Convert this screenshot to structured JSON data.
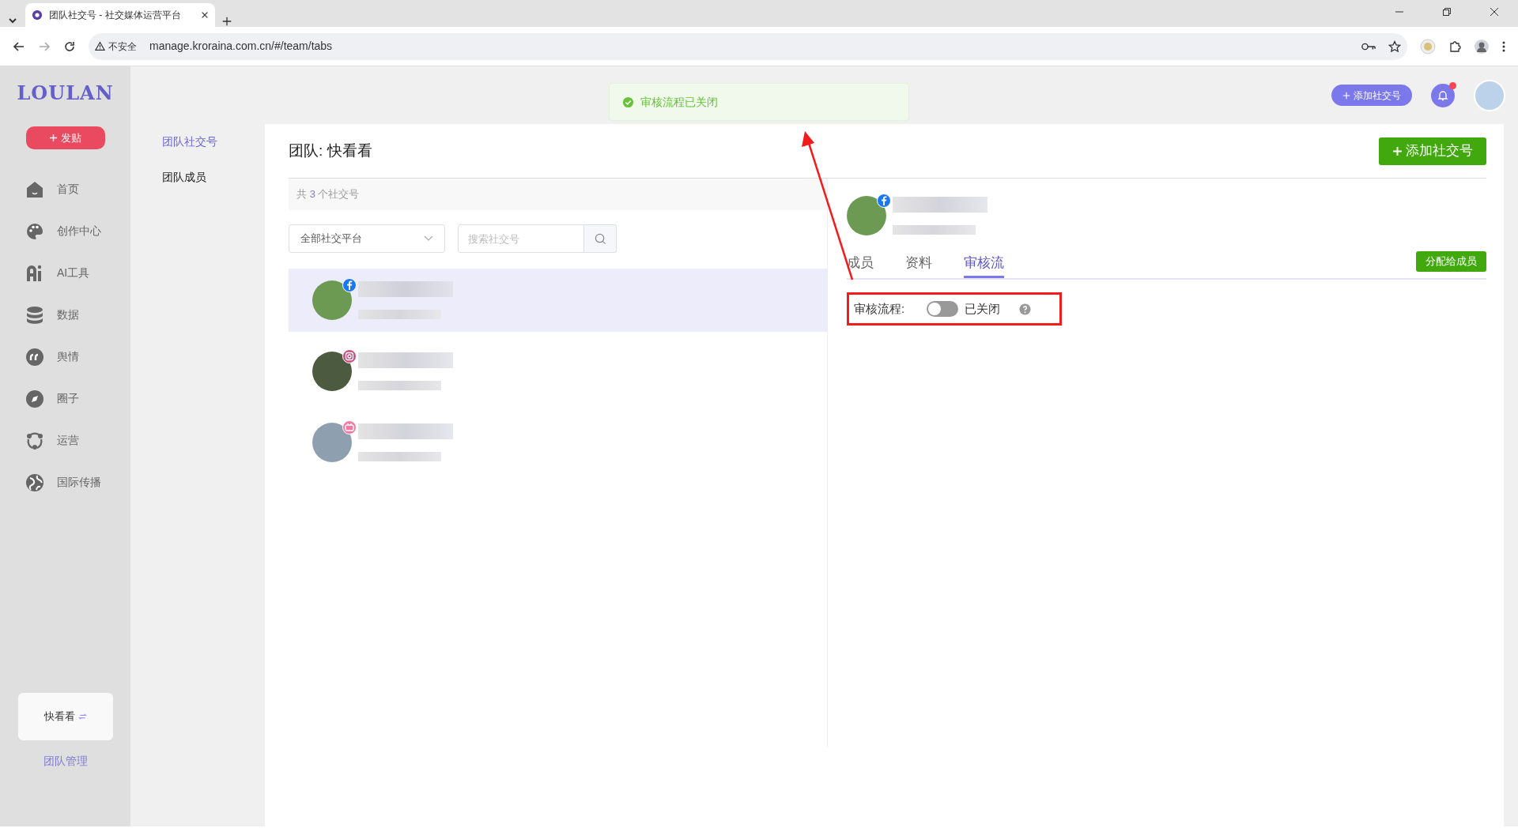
{
  "browser": {
    "tab_title": "团队社交号 - 社交媒体运营平台",
    "security_label": "不安全",
    "url": "manage.kroraina.com.cn/#/team/tabs"
  },
  "sidebar": {
    "logo": "LOULAN",
    "post_button": "发贴",
    "nav_items": [
      {
        "label": "首页"
      },
      {
        "label": "创作中心"
      },
      {
        "label": "AI工具"
      },
      {
        "label": "数据"
      },
      {
        "label": "舆情"
      },
      {
        "label": "圈子"
      },
      {
        "label": "运营"
      },
      {
        "label": "国际传播"
      }
    ],
    "team_switcher": "快看看",
    "team_manage_link": "团队管理"
  },
  "submenu": [
    {
      "label": "团队社交号",
      "selected": true
    },
    {
      "label": "团队成员",
      "selected": false
    }
  ],
  "header": {
    "add_button": "添加社交号",
    "notification_unread": true
  },
  "toast": {
    "kind": "success",
    "message": "审核流程已关闭"
  },
  "page": {
    "title": "团队: 快看看",
    "add_button": "添加社交号",
    "count": {
      "prefix": "共",
      "number": "3",
      "suffix": "个社交号"
    },
    "platform_filter": {
      "value": "全部社交平台"
    },
    "search": {
      "placeholder": "搜索社交号"
    },
    "accounts": [
      {
        "kind": "facebook",
        "selected": true
      },
      {
        "kind": "instagram",
        "selected": false
      },
      {
        "kind": "bilibili",
        "selected": false
      }
    ],
    "detail": {
      "kind": "facebook",
      "tabs": [
        {
          "label": "成员",
          "selected": false
        },
        {
          "label": "资料",
          "selected": false
        },
        {
          "label": "审核流",
          "selected": true
        }
      ],
      "assign_button": "分配给成员",
      "review": {
        "label": "审核流程:",
        "on": false,
        "status": "已关闭"
      }
    }
  }
}
